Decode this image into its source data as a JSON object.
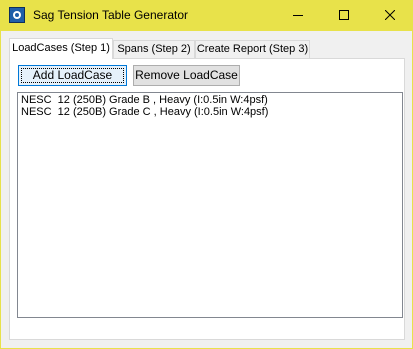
{
  "window": {
    "title": "Sag Tension Table Generator",
    "title_bar_color": "#e8e24a"
  },
  "caption_buttons": {
    "minimize_icon": "minimize-icon",
    "maximize_icon": "maximize-icon",
    "close_icon": "close-icon"
  },
  "tabs": [
    {
      "label": "LoadCases (Step 1)",
      "selected": true
    },
    {
      "label": "Spans (Step 2)",
      "selected": false
    },
    {
      "label": "Create Report (Step 3)",
      "selected": false
    }
  ],
  "toolbar": {
    "add_label": "Add LoadCase",
    "remove_label": "Remove LoadCase"
  },
  "loadcases": [
    "NESC  12 (250B) Grade B , Heavy (I:0.5in W:4psf)",
    "NESC  12 (250B) Grade C , Heavy (I:0.5in W:4psf)"
  ]
}
